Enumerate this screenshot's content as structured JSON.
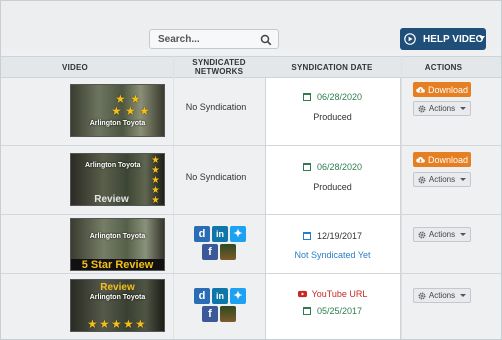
{
  "search": {
    "placeholder": "Search..."
  },
  "help_button": {
    "label": "HELP VIDEO"
  },
  "table": {
    "headers": {
      "video": "VIDEO",
      "networks": "SYNDICATED NETWORKS",
      "date": "SYNDICATION DATE",
      "actions": "ACTIONS"
    },
    "rows": [
      {
        "thumb": {
          "dealer": "Arlington Toyota",
          "text": ""
        },
        "networks": "No Syndication",
        "date": "06/28/2020",
        "status": "Produced",
        "download": "Download",
        "actions": "Actions"
      },
      {
        "thumb": {
          "dealer": "Arlington Toyota",
          "text": "Review"
        },
        "networks": "No Syndication",
        "date": "06/28/2020",
        "status": "Produced",
        "download": "Download",
        "actions": "Actions"
      },
      {
        "thumb": {
          "dealer": "Arlington Toyota",
          "text": "5 Star Review"
        },
        "date": "12/19/2017",
        "status": "Not Syndicated Yet",
        "actions": "Actions"
      },
      {
        "thumb": {
          "dealer": "Arlington Toyota",
          "text": "Review"
        },
        "youtube": "YouTube URL",
        "date": "05/25/2017",
        "actions": "Actions"
      }
    ]
  },
  "colors": {
    "help_bg": "#1f4e79",
    "download_bg": "#e67e22",
    "date_green": "#2e7d4f",
    "not_synced_blue": "#2a7dc8",
    "youtube_red": "#c62828"
  }
}
